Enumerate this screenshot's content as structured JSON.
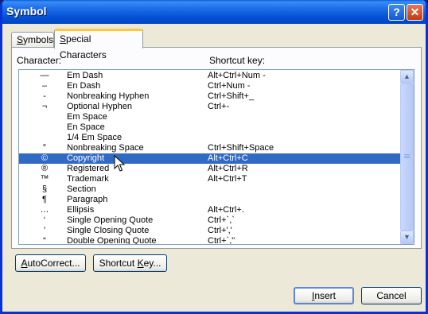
{
  "window": {
    "title": "Symbol",
    "help_label": "?",
    "close_label": "✕"
  },
  "tabs": [
    {
      "label_u": "S",
      "label_rest": "ymbols"
    },
    {
      "label_u": "S",
      "label_rest": "pecial Characters"
    }
  ],
  "headers": {
    "character": "Character:",
    "shortcut": "Shortcut key:"
  },
  "rows": [
    {
      "sym": "—",
      "name": "Em Dash",
      "key": "Alt+Ctrl+Num -"
    },
    {
      "sym": "–",
      "name": "En Dash",
      "key": "Ctrl+Num -"
    },
    {
      "sym": "-",
      "name": "Nonbreaking Hyphen",
      "key": "Ctrl+Shift+_"
    },
    {
      "sym": "¬",
      "name": "Optional Hyphen",
      "key": "Ctrl+-"
    },
    {
      "sym": "",
      "name": "Em Space",
      "key": ""
    },
    {
      "sym": "",
      "name": "En Space",
      "key": ""
    },
    {
      "sym": "",
      "name": "1/4 Em Space",
      "key": ""
    },
    {
      "sym": "°",
      "name": "Nonbreaking Space",
      "key": "Ctrl+Shift+Space"
    },
    {
      "sym": "©",
      "name": "Copyright",
      "key": "Alt+Ctrl+C"
    },
    {
      "sym": "®",
      "name": "Registered",
      "key": "Alt+Ctrl+R"
    },
    {
      "sym": "™",
      "name": "Trademark",
      "key": "Alt+Ctrl+T"
    },
    {
      "sym": "§",
      "name": "Section",
      "key": ""
    },
    {
      "sym": "¶",
      "name": "Paragraph",
      "key": ""
    },
    {
      "sym": "…",
      "name": "Ellipsis",
      "key": "Alt+Ctrl+."
    },
    {
      "sym": "‘",
      "name": "Single Opening Quote",
      "key": "Ctrl+`,`"
    },
    {
      "sym": "’",
      "name": "Single Closing Quote",
      "key": "Ctrl+','"
    },
    {
      "sym": "“",
      "name": "Double Opening Quote",
      "key": "Ctrl+`,\""
    }
  ],
  "selected_index": 8,
  "scroll": {
    "up": "▲",
    "down": "▼"
  },
  "buttons": {
    "autocorrect_u": "A",
    "autocorrect_rest": "utoCorrect...",
    "shortcut_pre": "Shortcut ",
    "shortcut_u": "K",
    "shortcut_rest": "ey...",
    "insert_u": "I",
    "insert_rest": "nsert",
    "cancel": "Cancel"
  },
  "colors": {
    "titlebar": "#0453d6",
    "selection": "#316ac5",
    "tab_highlight": "#ffc73c"
  }
}
